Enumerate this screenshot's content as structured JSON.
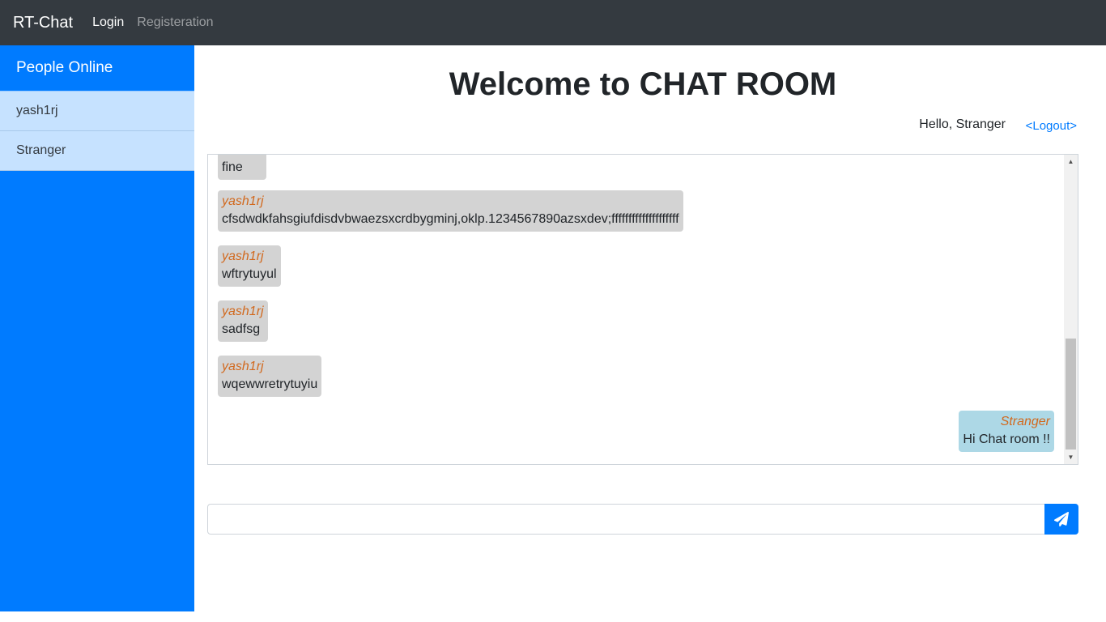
{
  "navbar": {
    "brand": "RT-Chat",
    "links": [
      {
        "label": "Login"
      },
      {
        "label": "Registeration"
      }
    ]
  },
  "sidebar": {
    "title": "People Online",
    "users": [
      {
        "name": "yash1rj"
      },
      {
        "name": "Stranger"
      }
    ]
  },
  "main": {
    "title": "Welcome to CHAT ROOM",
    "greeting": "Hello, Stranger",
    "logout_label": "<Logout>"
  },
  "messages": [
    {
      "author": "",
      "text": "fine",
      "own": false
    },
    {
      "author": "yash1rj",
      "text": "cfsdwdkfahsgiufdisdvbwaezsxcrdbygminj,oklp.1234567890azsxdev;ffffffffffffffffffff",
      "own": false
    },
    {
      "author": "yash1rj",
      "text": "wftrytuyul",
      "own": false
    },
    {
      "author": "yash1rj",
      "text": "sadfsg",
      "own": false
    },
    {
      "author": "yash1rj",
      "text": "wqewwretrytuyiu",
      "own": false
    },
    {
      "author": "Stranger",
      "text": "Hi Chat room !!",
      "own": true
    }
  ],
  "composer": {
    "value": "",
    "placeholder": "",
    "send_icon": "paper-plane-icon"
  },
  "colors": {
    "navbar": "#343a40",
    "sidebar": "#007bff",
    "sidebar_item": "#c6e2ff",
    "message_bubble": "#d3d3d3",
    "own_bubble": "#add8e6",
    "author": "#d2691e"
  }
}
